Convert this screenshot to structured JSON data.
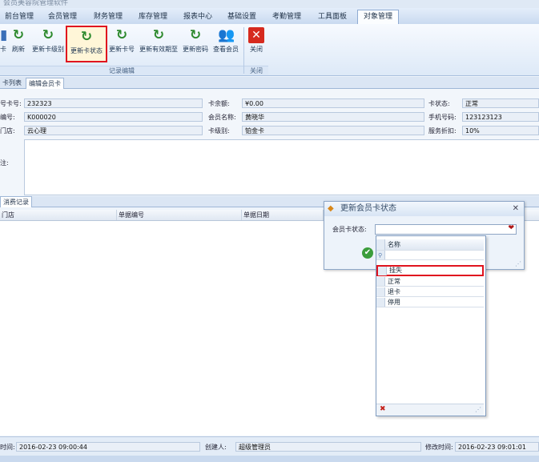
{
  "window": {
    "title": "会员美容院管理软件"
  },
  "menu": {
    "tabs": [
      {
        "label": "前台管理"
      },
      {
        "label": "会员管理"
      },
      {
        "label": "财务管理"
      },
      {
        "label": "库存管理"
      },
      {
        "label": "报表中心"
      },
      {
        "label": "基础设置"
      },
      {
        "label": "考勤管理"
      },
      {
        "label": "工具面板"
      },
      {
        "label": "对象管理"
      }
    ],
    "active": "对象管理"
  },
  "ribbon": {
    "buttons": [
      {
        "label": "刷新"
      },
      {
        "label": "更新卡级别"
      },
      {
        "label": "更新卡状态"
      },
      {
        "label": "更新卡号"
      },
      {
        "label": "更新有效期至"
      },
      {
        "label": "更新密码"
      },
      {
        "label": "查看会员"
      },
      {
        "label": "关闭"
      }
    ],
    "left_stub": "卡",
    "group_record": "记录编辑",
    "group_close": "关闭"
  },
  "tabs": {
    "list": "卡列表",
    "edit": "编辑会员卡"
  },
  "form": {
    "card_no_label": "号卡号:",
    "card_no": "232323",
    "balance_label": "卡余额:",
    "balance": "¥0.00",
    "status_label": "卡状态:",
    "status": "正常",
    "member_no_label": "编号:",
    "member_no": "K000020",
    "member_name_label": "会员名称:",
    "member_name": "黄晓华",
    "phone_label": "手机号码:",
    "phone": "123123123",
    "store_label": "门店:",
    "store": "云心理",
    "level_label": "卡级别:",
    "level": "铂金卡",
    "discount_label": "服务折扣:",
    "discount": "10%",
    "remark_label": "注:"
  },
  "records": {
    "tab": "消费记录",
    "columns": [
      "门店",
      "单据编号",
      "单据日期"
    ]
  },
  "status_bar": {
    "created_label": "时间:",
    "created": "2016-02-23 09:00:44",
    "creator_label": "创建人:",
    "creator": "超级管理员",
    "modified_label": "修改时间:",
    "modified": "2016-02-23 09:01:01"
  },
  "dialog": {
    "title": "更新会员卡状态",
    "field_label": "会员卡状态:",
    "dropdown_header": "名称",
    "options": [
      "挂失",
      "正常",
      "退卡",
      "停用"
    ],
    "highlighted": "挂失"
  }
}
